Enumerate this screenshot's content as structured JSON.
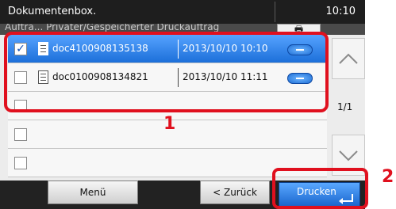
{
  "window": {
    "title": "Dokumentenbox.",
    "time": "10:10"
  },
  "breadcrumb": {
    "text": "Auftra... Privater/Gespeicherter Druckauftrag"
  },
  "toolbar": {
    "printer_icon": "printer-icon",
    "printer_glyph": "🖶"
  },
  "list": {
    "rows": [
      {
        "checked": true,
        "check_glyph": "✓",
        "name": "doc4100908135138",
        "date": "2013/10/10 10:10"
      },
      {
        "checked": false,
        "check_glyph": "",
        "name": "doc0100908134821",
        "date": "2013/10/10 11:11"
      },
      {
        "checked": false,
        "check_glyph": ""
      },
      {
        "checked": false,
        "check_glyph": ""
      },
      {
        "checked": false,
        "check_glyph": ""
      }
    ]
  },
  "pager": {
    "page": "1/1"
  },
  "buttons": {
    "menu": "Menü",
    "back": "< Zurück",
    "print": "Drucken"
  },
  "callouts": {
    "list": "1",
    "print": "2"
  },
  "colors": {
    "accent": "#1c6fd9",
    "highlight": "#e0101e"
  }
}
